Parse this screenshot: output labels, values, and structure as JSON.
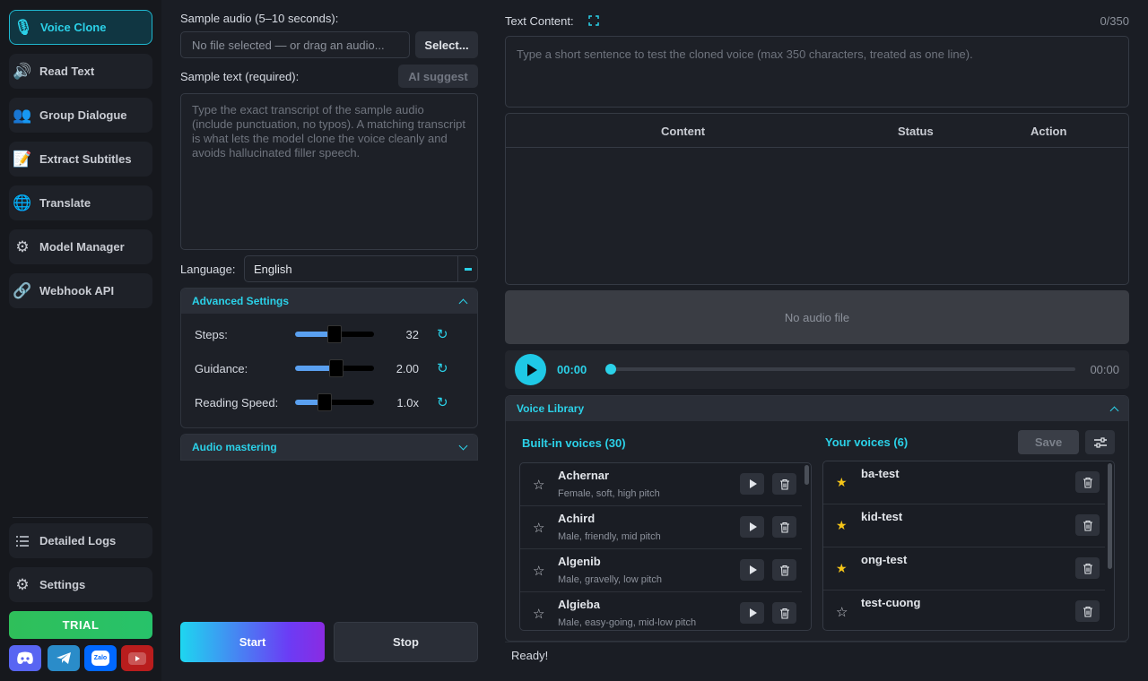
{
  "sidebar": {
    "items": [
      {
        "label": "Voice Clone",
        "icon": "microphone-icon"
      },
      {
        "label": "Read Text",
        "icon": "speaker-icon"
      },
      {
        "label": "Group Dialogue",
        "icon": "people-icon"
      },
      {
        "label": "Extract Subtitles",
        "icon": "memo-icon"
      },
      {
        "label": "Translate",
        "icon": "globe-icon"
      },
      {
        "label": "Model Manager",
        "icon": "gear-icon"
      },
      {
        "label": "Webhook API",
        "icon": "link-icon"
      }
    ],
    "bottom": [
      {
        "label": "Detailed Logs",
        "icon": "list-icon"
      },
      {
        "label": "Settings",
        "icon": "gear-icon"
      }
    ],
    "trial_label": "TRIAL",
    "social": [
      "discord-icon",
      "telegram-icon",
      "zalo-icon",
      "youtube-icon"
    ],
    "zalo_text": "Zalo"
  },
  "clone": {
    "sample_audio_label": "Sample audio (5–10 seconds):",
    "file_placeholder": "No file selected — or drag an audio...",
    "select_label": "Select...",
    "sample_text_label": "Sample text (required):",
    "ai_suggest_label": "AI suggest",
    "sample_text_placeholder": "Type the exact transcript of the sample audio (include punctuation, no typos). A matching transcript is what lets the model clone the voice cleanly and avoids hallucinated filler speech.",
    "language_label": "Language:",
    "language_value": "English",
    "advanced_title": "Advanced Settings",
    "sliders": [
      {
        "label": "Steps:",
        "value": "32",
        "fraction": 0.5
      },
      {
        "label": "Guidance:",
        "value": "2.00",
        "fraction": 0.52
      },
      {
        "label": "Reading Speed:",
        "value": "1.0x",
        "fraction": 0.38
      }
    ],
    "mastering_title": "Audio mastering",
    "start_label": "Start",
    "stop_label": "Stop"
  },
  "content": {
    "text_content_label": "Text Content:",
    "counter": "0/350",
    "placeholder": "Type a short sentence to test the cloned voice (max 350 characters, treated as one line).",
    "table_headers": [
      "Content",
      "Status",
      "Action"
    ],
    "no_audio": "No audio file",
    "time_current": "00:00",
    "time_total": "00:00",
    "progress": 0
  },
  "library": {
    "title": "Voice Library",
    "builtin_title": "Built-in voices (30)",
    "your_title": "Your voices (6)",
    "save_label": "Save",
    "builtin": [
      {
        "name": "Achernar",
        "desc": "Female, soft, high pitch"
      },
      {
        "name": "Achird",
        "desc": "Male, friendly, mid pitch"
      },
      {
        "name": "Algenib",
        "desc": "Male, gravelly, low pitch"
      },
      {
        "name": "Algieba",
        "desc": "Male, easy-going, mid-low pitch"
      }
    ],
    "yours": [
      {
        "name": "ba-test",
        "favorite": true
      },
      {
        "name": "kid-test",
        "favorite": true
      },
      {
        "name": "ong-test",
        "favorite": true
      },
      {
        "name": "test-cuong",
        "favorite": false
      }
    ]
  },
  "status": "Ready!"
}
